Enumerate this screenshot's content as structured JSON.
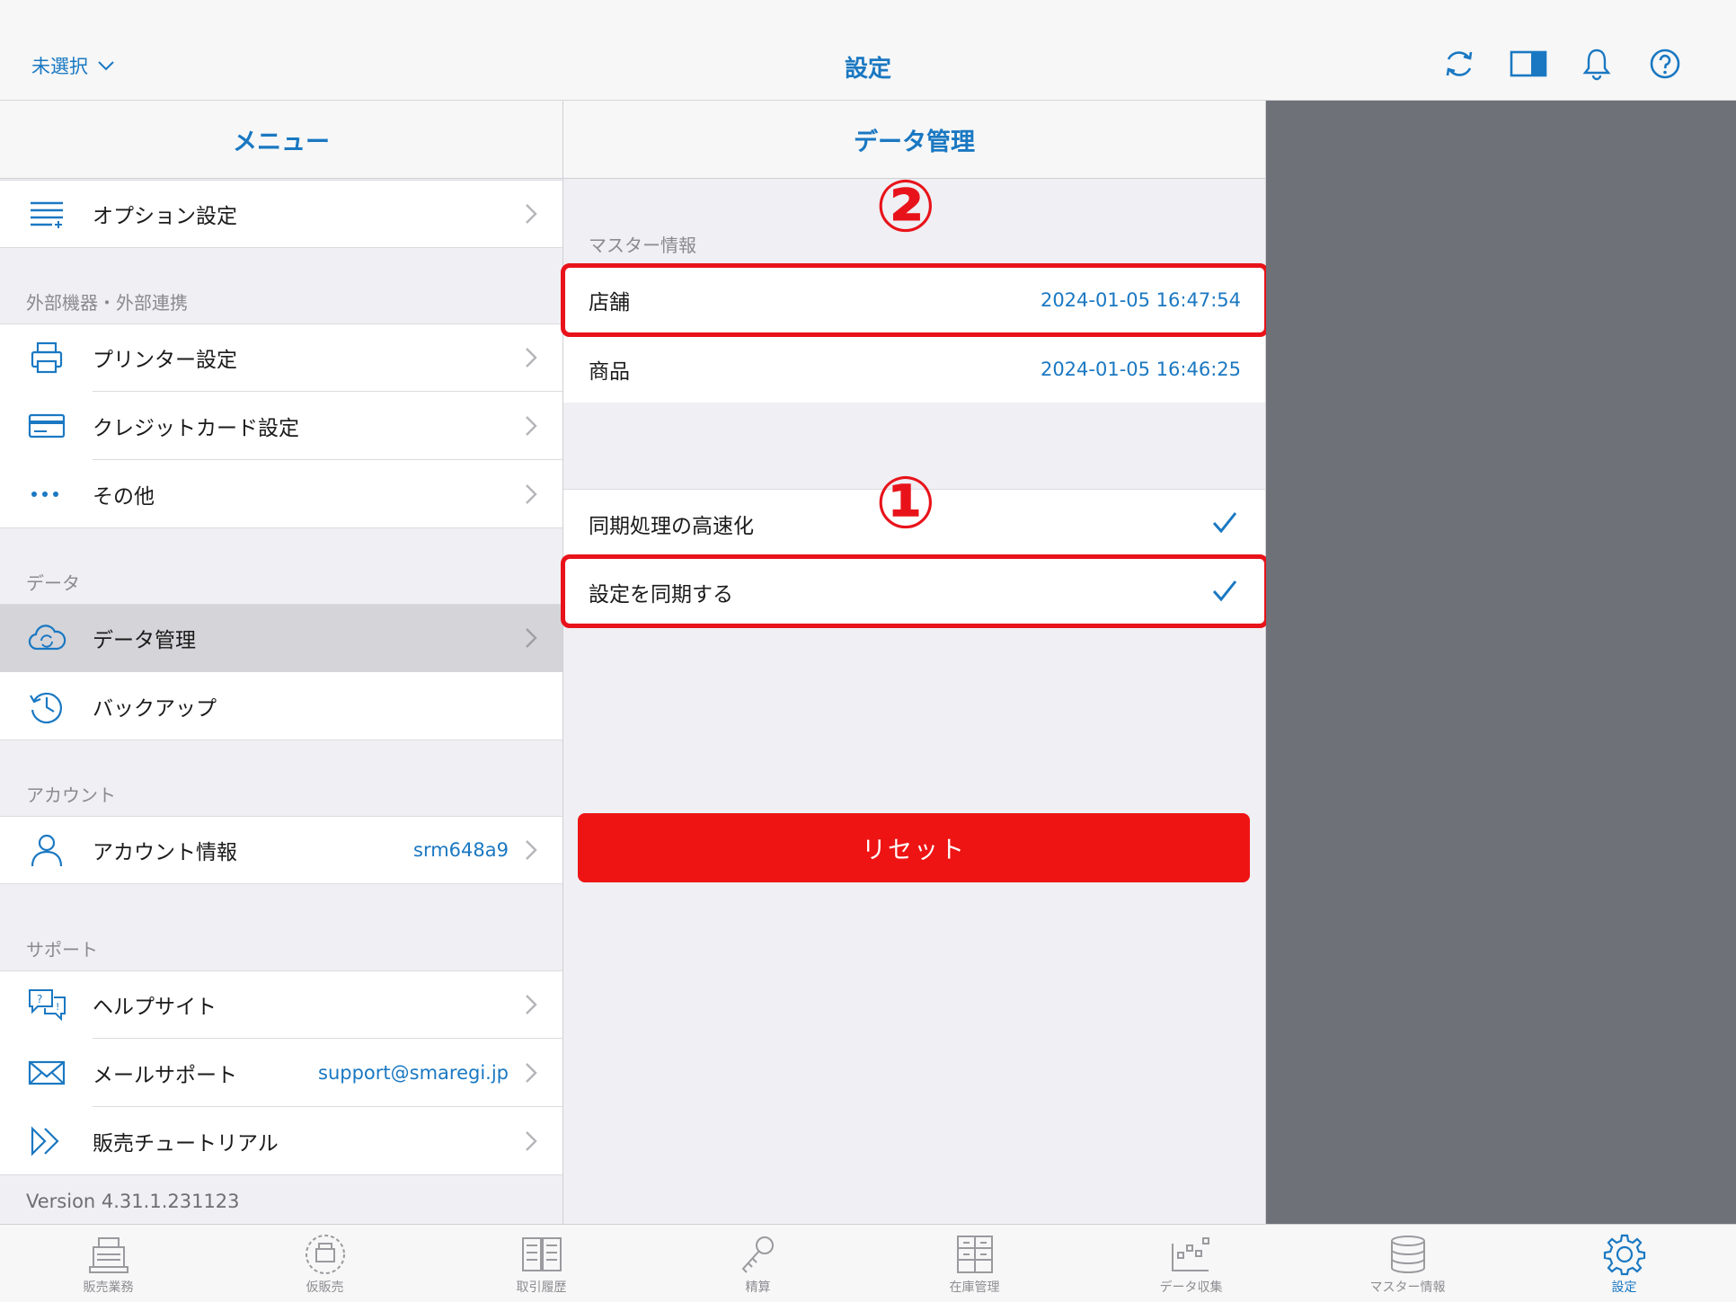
{
  "topbar": {
    "store_selector": "未選択",
    "title": "設定",
    "icons": [
      "refresh-icon",
      "split-view-icon",
      "bell-icon",
      "help-icon"
    ]
  },
  "menu": {
    "header": "メニュー",
    "option_settings": "オプション設定",
    "sections": {
      "external": "外部機器・外部連携",
      "data": "データ",
      "account": "アカウント",
      "support": "サポート"
    },
    "items": {
      "printer": "プリンター設定",
      "credit": "クレジットカード設定",
      "other": "その他",
      "data_management": "データ管理",
      "backup": "バックアップ",
      "account_info": "アカウント情報",
      "account_value": "srm648a9",
      "help_site": "ヘルプサイト",
      "mail_support": "メールサポート",
      "mail_value": "support@smaregi.jp",
      "tutorial": "販売チュートリアル"
    },
    "version": "Version 4.31.1.231123"
  },
  "detail": {
    "header": "データ管理",
    "master_section": "マスター情報",
    "store_label": "店舗",
    "store_value": "2024-01-05 16:47:54",
    "product_label": "商品",
    "product_value": "2024-01-05 16:46:25",
    "sync_speedup": "同期処理の高速化",
    "sync_settings": "設定を同期する",
    "reset": "リセット",
    "annotation_1": "①",
    "annotation_2": "②"
  },
  "tabs": [
    "販売業務",
    "仮販売",
    "取引履歴",
    "精算",
    "在庫管理",
    "データ収集",
    "マスター情報",
    "設定"
  ],
  "colors": {
    "accent": "#1a78c2",
    "danger": "#ee1414",
    "annotation": "#e8131a"
  }
}
